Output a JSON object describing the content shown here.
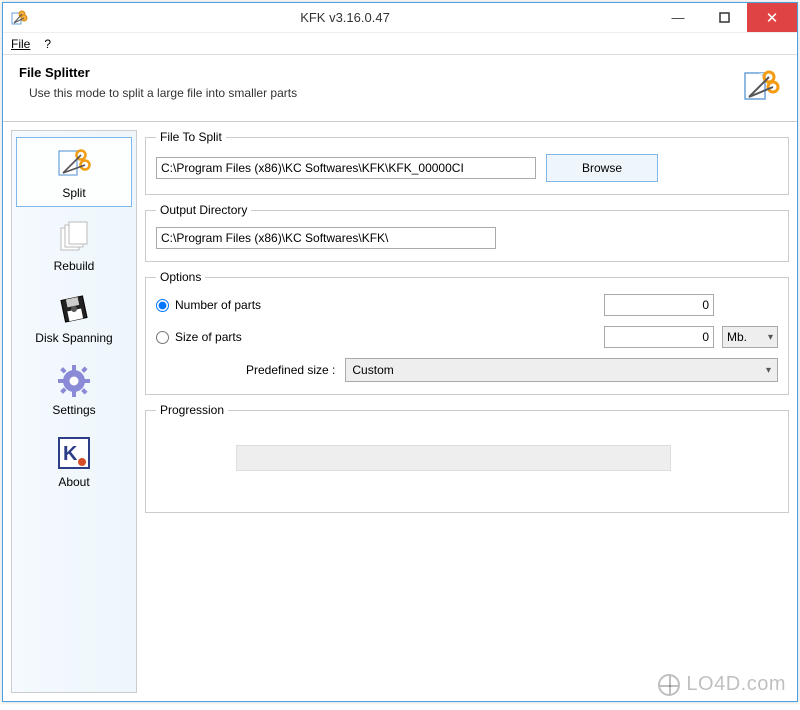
{
  "window": {
    "title": "KFK v3.16.0.47"
  },
  "menubar": {
    "file": "File",
    "help": "?"
  },
  "header": {
    "title": "File Splitter",
    "subtitle": "Use this mode to split a large file into smaller parts"
  },
  "sidebar": {
    "items": [
      {
        "label": "Split",
        "icon": "scissors-file-icon",
        "active": true
      },
      {
        "label": "Rebuild",
        "icon": "stack-files-icon",
        "active": false
      },
      {
        "label": "Disk Spanning",
        "icon": "floppy-disk-icon",
        "active": false
      },
      {
        "label": "Settings",
        "icon": "gear-icon",
        "active": false
      },
      {
        "label": "About",
        "icon": "kc-logo-icon",
        "active": false
      }
    ]
  },
  "main": {
    "file_to_split": {
      "legend": "File To Split",
      "value": "C:\\Program Files (x86)\\KC Softwares\\KFK\\KFK_00000CI",
      "browse": "Browse"
    },
    "output_dir": {
      "legend": "Output Directory",
      "value": "C:\\Program Files (x86)\\KC Softwares\\KFK\\"
    },
    "options": {
      "legend": "Options",
      "number_label": "Number of parts",
      "number_value": "0",
      "size_label": "Size of parts",
      "size_value": "0",
      "size_unit": "Mb.",
      "predef_label": "Predefined size :",
      "predef_value": "Custom"
    },
    "progression": {
      "legend": "Progression"
    }
  },
  "watermark": "LO4D.com"
}
